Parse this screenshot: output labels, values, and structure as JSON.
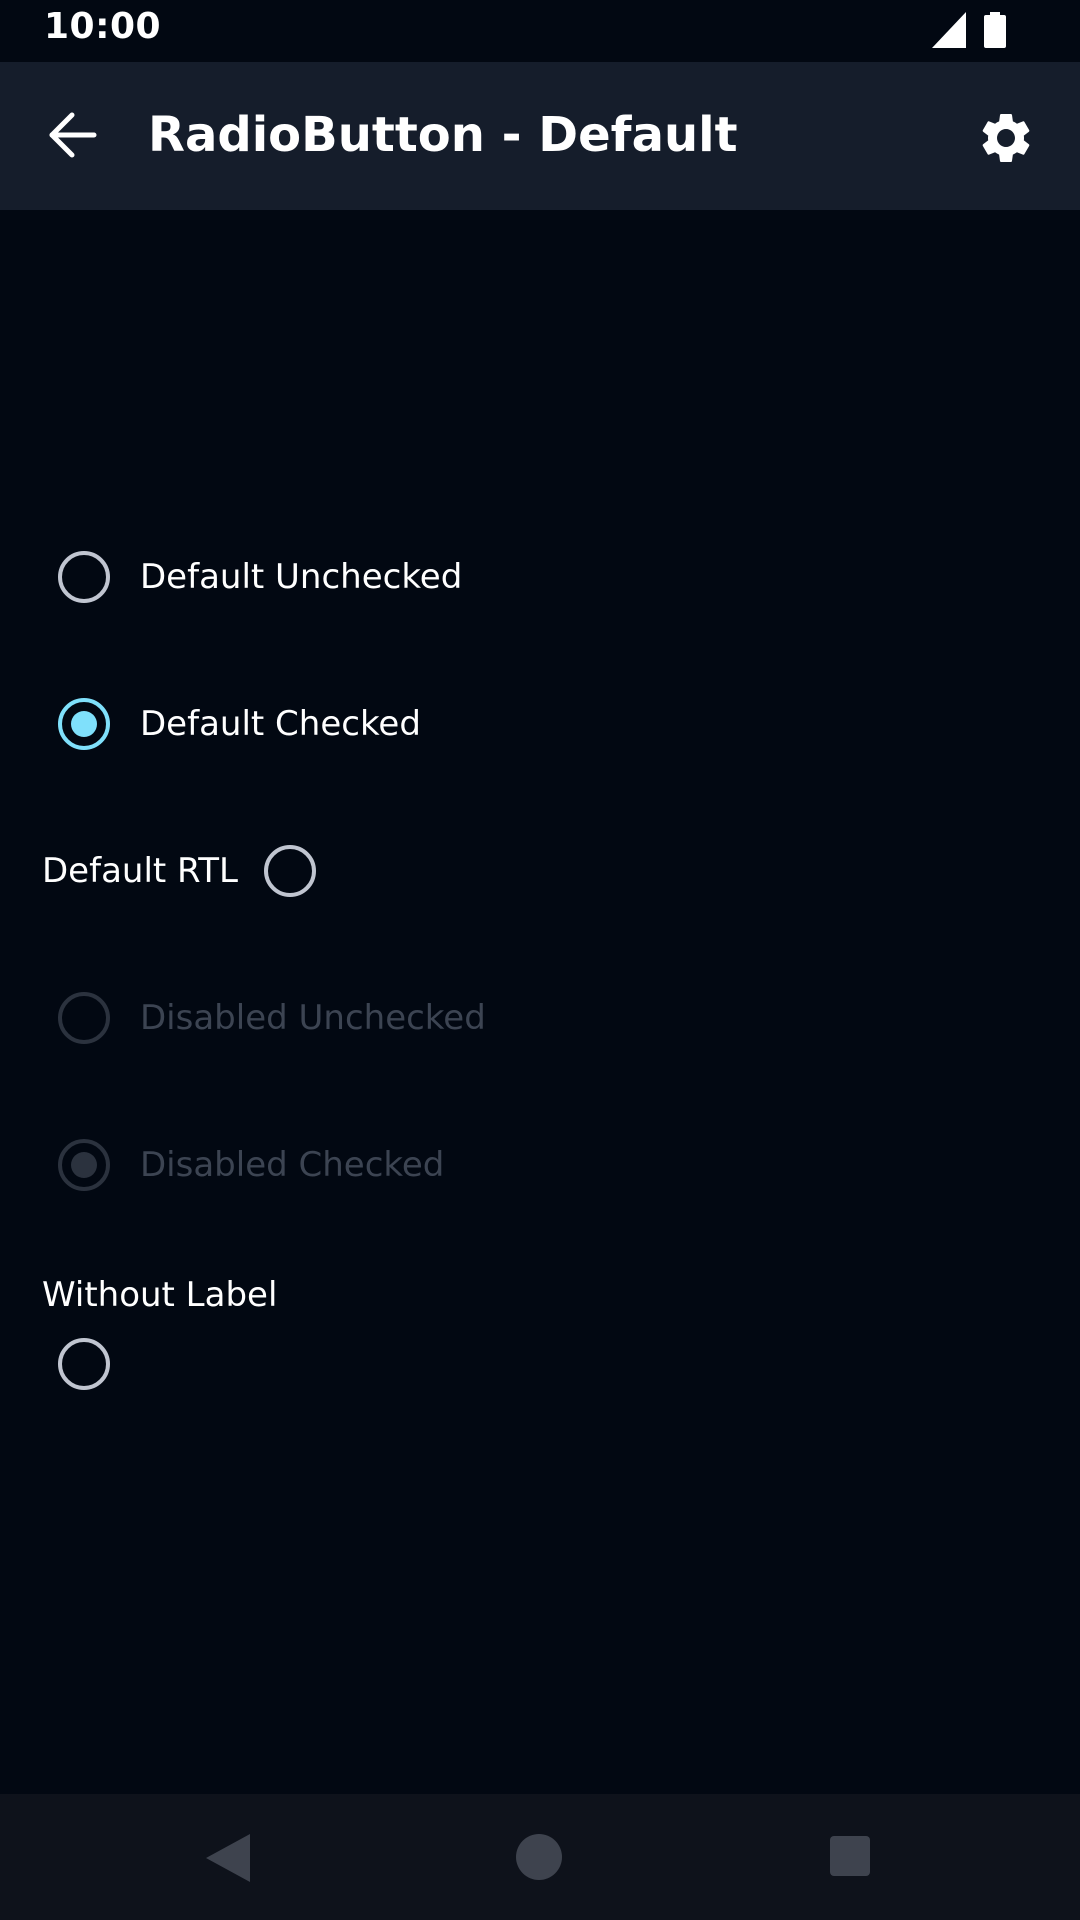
{
  "status_bar": {
    "time": "10:00",
    "icons": [
      "signal-icon",
      "battery-icon"
    ]
  },
  "app_bar": {
    "title": "RadioButton - Default",
    "back_icon": "arrow-back-icon",
    "settings_icon": "gear-icon"
  },
  "radios": {
    "default_unchecked": {
      "label": "Default Unchecked",
      "checked": false,
      "enabled": true
    },
    "default_checked": {
      "label": "Default Checked",
      "checked": true,
      "enabled": true
    },
    "default_rtl": {
      "label": "Default RTL",
      "checked": false,
      "enabled": true
    },
    "disabled_unchecked": {
      "label": "Disabled Unchecked",
      "checked": false,
      "enabled": false
    },
    "disabled_checked": {
      "label": "Disabled Checked",
      "checked": true,
      "enabled": false
    },
    "without_label": {
      "section_title": "Without Label",
      "checked": false,
      "enabled": true
    }
  },
  "colors": {
    "background": "#020812",
    "app_bar": "#151d2b",
    "accent": "#7fe0fb",
    "radio_outline": "#c0c5d0",
    "disabled": "#2b323e",
    "nav_bar": "#0e121b"
  },
  "nav_bar": {
    "icons": [
      "nav-back-icon",
      "nav-home-icon",
      "nav-recents-icon"
    ]
  }
}
